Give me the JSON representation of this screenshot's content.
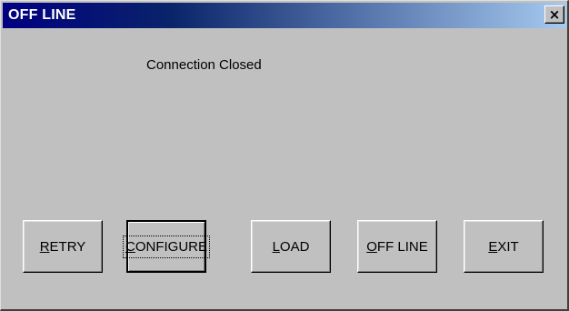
{
  "window": {
    "title": "OFF LINE",
    "close_glyph": "×"
  },
  "status_text": "Connection Closed",
  "buttons": [
    {
      "id": "retry",
      "accel": "R",
      "rest": "ETRY"
    },
    {
      "id": "configure",
      "accel": "C",
      "rest": "ONFIGURE",
      "default": true
    },
    {
      "id": "load",
      "accel": "L",
      "rest": "OAD"
    },
    {
      "id": "offline",
      "accel": "O",
      "rest": "FF LINE"
    },
    {
      "id": "exit",
      "accel": "E",
      "rest": "XIT"
    }
  ]
}
